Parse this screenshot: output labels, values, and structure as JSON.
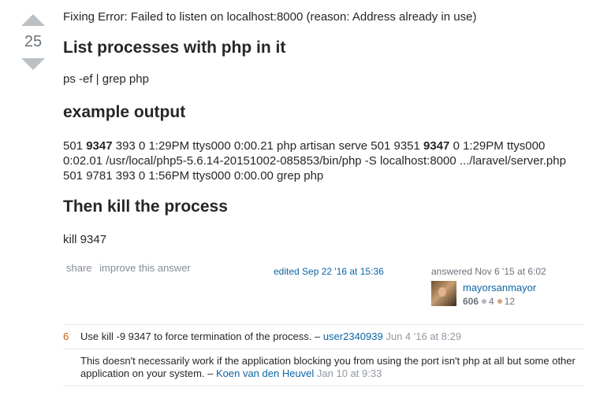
{
  "vote": {
    "count": "25"
  },
  "answer": {
    "intro": "Fixing Error: Failed to listen on localhost:8000 (reason: Address already in use)",
    "heading1": "List processes with php in it",
    "command1": "ps -ef | grep php",
    "heading2": "example output",
    "output": {
      "seg1": "501 ",
      "pid1": "9347",
      "seg2": " 393 0 1:29PM ttys000 0:00.21 php artisan serve 501 9351 ",
      "pid2": "9347",
      "seg3": " 0 1:29PM ttys000 0:02.01 /usr/local/php5-5.6.14-20151002-085853/bin/php -S localhost:8000 .../laravel/server.php 501 9781 393 0 1:56PM ttys000 0:00.00 grep php"
    },
    "heading3": "Then kill the process",
    "command2": "kill 9347"
  },
  "post_menu": {
    "share": "share",
    "improve": "improve this answer"
  },
  "edited": "edited Sep 22 '16 at 15:36",
  "answered": "answered Nov 6 '15 at 6:02",
  "user": {
    "name": "mayorsanmayor",
    "reputation": "606",
    "silver": "4",
    "bronze": "12",
    "silver_color": "#b4b8bc",
    "bronze_color": "#d1a684"
  },
  "comments": [
    {
      "score": "6",
      "text": "Use kill -9 9347 to force termination of the process. – ",
      "user": "user2340939",
      "date": "Jun 4 '16 at 8:29"
    },
    {
      "score": "",
      "text": "This doesn't necessarily work if the application blocking you from using the port isn't php at all but some other application on your system. – ",
      "user": "Koen van den Heuvel",
      "date": "Jan 10 at 9:33"
    }
  ]
}
